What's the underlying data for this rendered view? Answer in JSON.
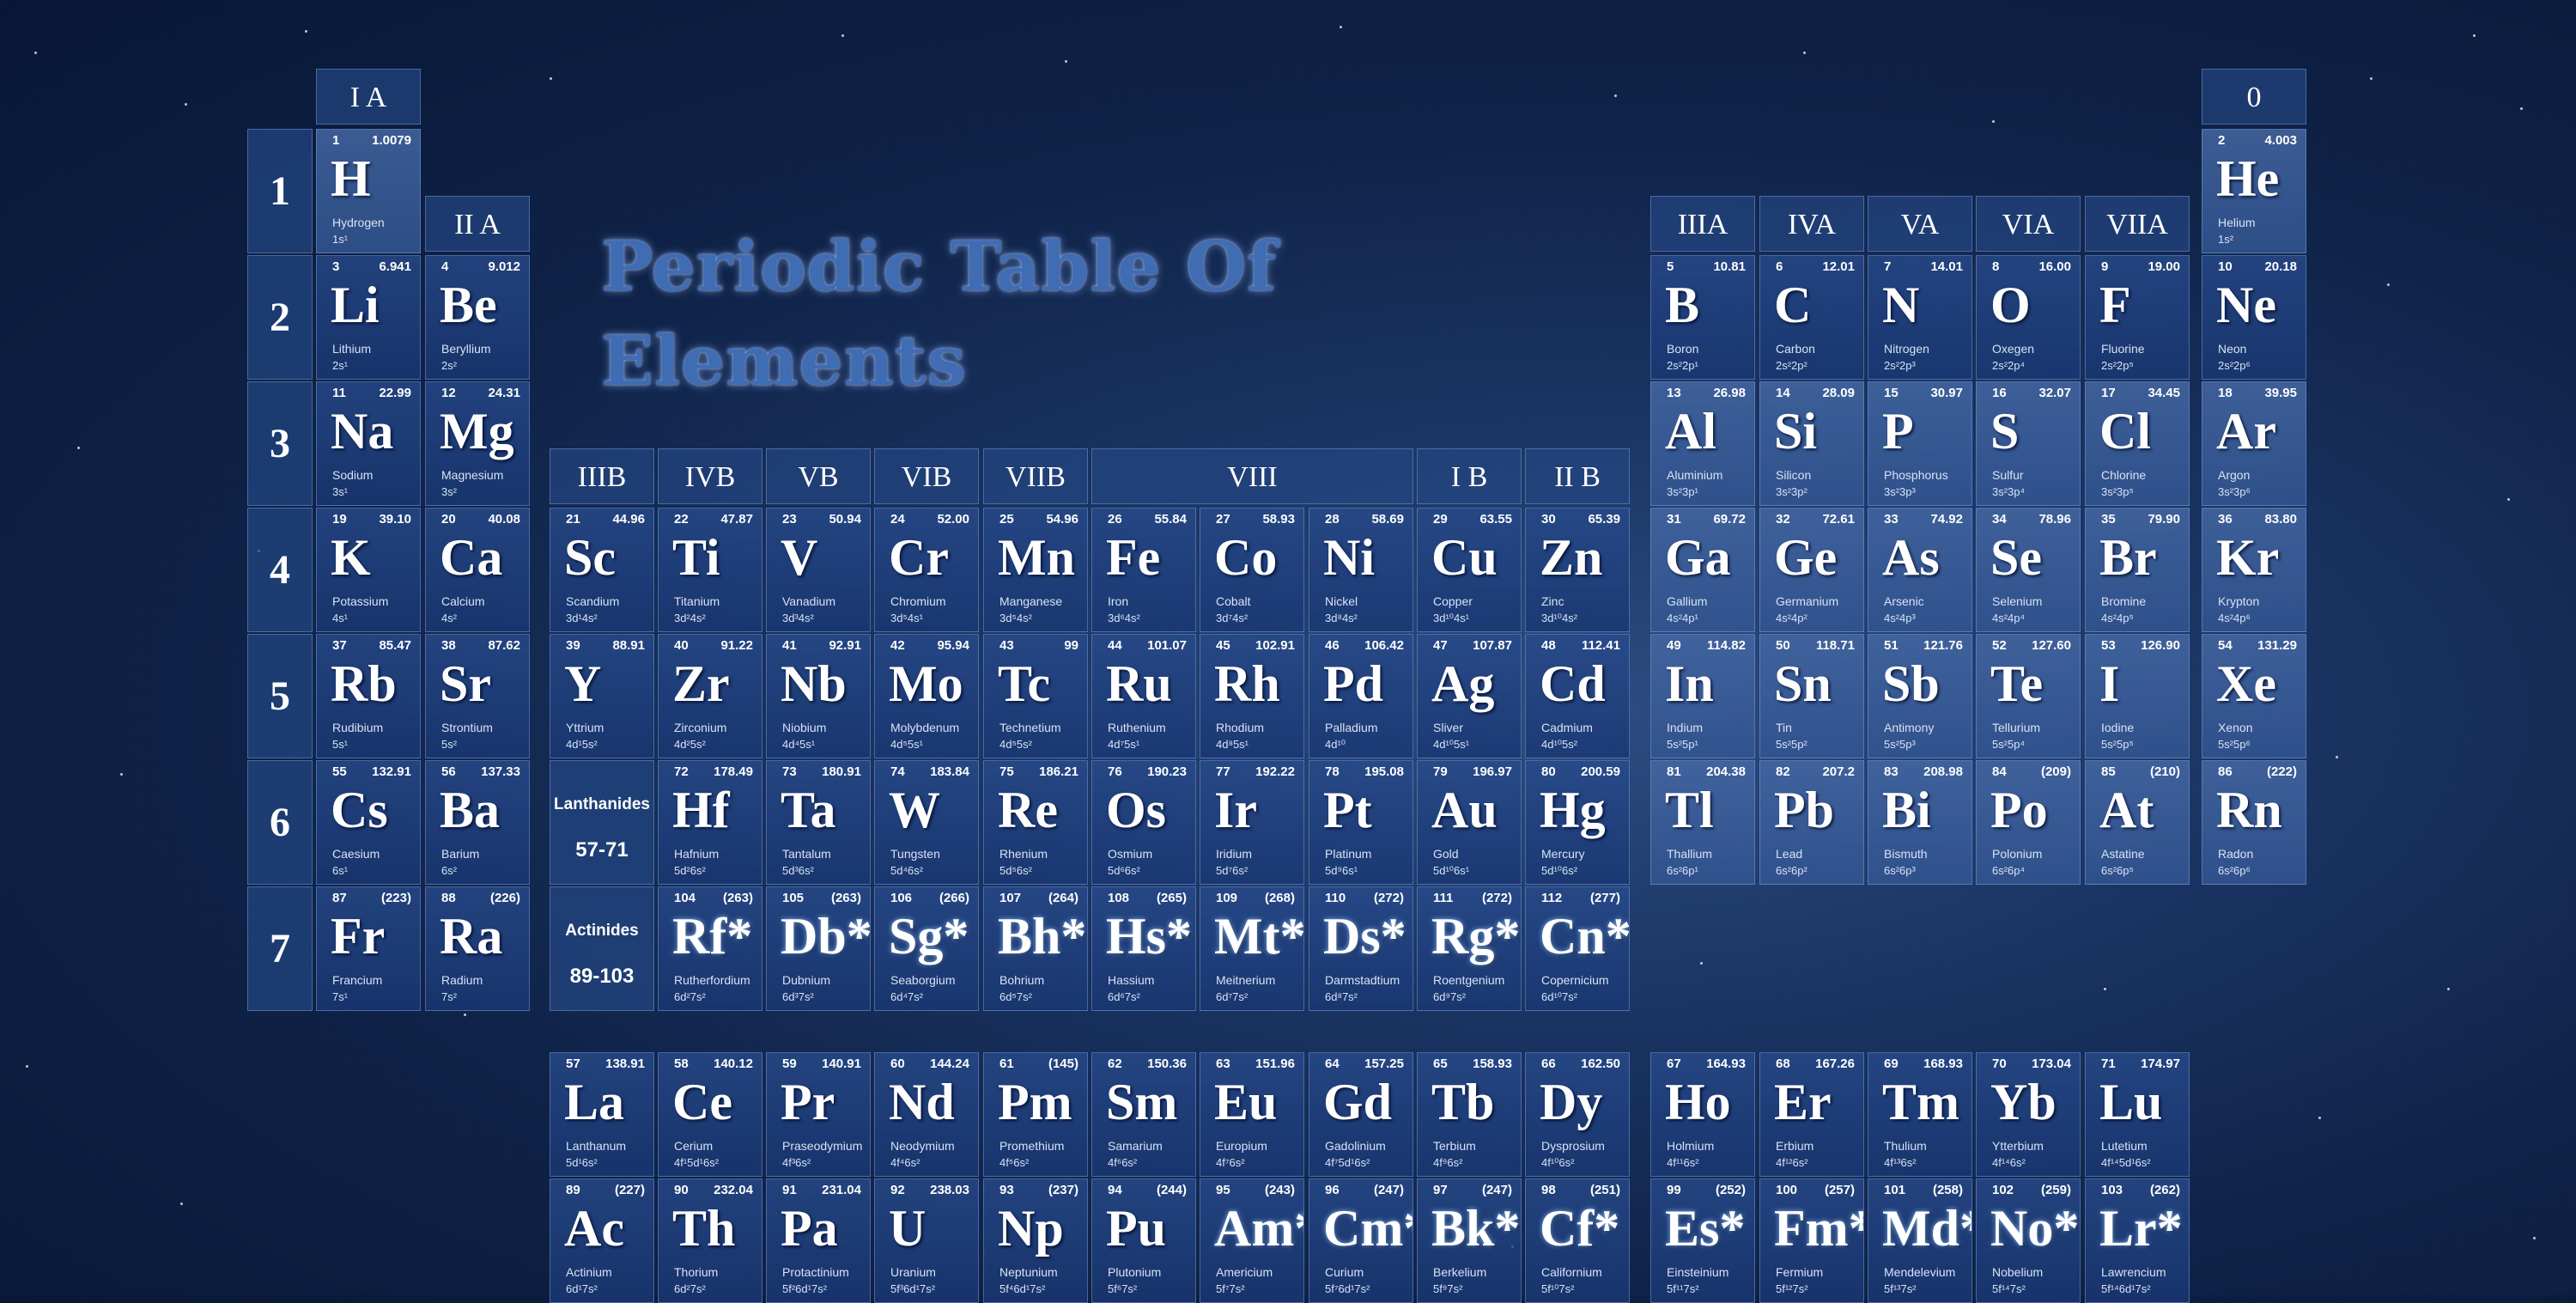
{
  "title": "Periodic Table Of Elements",
  "groups": [
    {
      "label": "I A"
    },
    {
      "label": "II A"
    },
    {
      "label": "IIIB"
    },
    {
      "label": "IVB"
    },
    {
      "label": "VB"
    },
    {
      "label": "VIB"
    },
    {
      "label": "VIIB"
    },
    {
      "label": "VIII"
    },
    {
      "label": "I B"
    },
    {
      "label": "II B"
    },
    {
      "label": "IIIA"
    },
    {
      "label": "IVA"
    },
    {
      "label": "VA"
    },
    {
      "label": "VIA"
    },
    {
      "label": "VIIA"
    },
    {
      "label": "0"
    }
  ],
  "periods": [
    "1",
    "2",
    "3",
    "4",
    "5",
    "6",
    "7"
  ],
  "series_labels": [
    {
      "l1": "Lanthanides",
      "l2": "57-71"
    },
    {
      "l1": "Actinides",
      "l2": "89-103"
    }
  ],
  "elements": [
    {
      "n": "1",
      "m": "1.0079",
      "s": "H",
      "name": "Hydrogen",
      "c": "1s¹"
    },
    {
      "n": "2",
      "m": "4.003",
      "s": "He",
      "name": "Helium",
      "c": "1s²"
    },
    {
      "n": "3",
      "m": "6.941",
      "s": "Li",
      "name": "Lithium",
      "c": "2s¹"
    },
    {
      "n": "4",
      "m": "9.012",
      "s": "Be",
      "name": "Beryllium",
      "c": "2s²"
    },
    {
      "n": "5",
      "m": "10.81",
      "s": "B",
      "name": "Boron",
      "c": "2s²2p¹"
    },
    {
      "n": "6",
      "m": "12.01",
      "s": "C",
      "name": "Carbon",
      "c": "2s²2p²"
    },
    {
      "n": "7",
      "m": "14.01",
      "s": "N",
      "name": "Nitrogen",
      "c": "2s²2p³"
    },
    {
      "n": "8",
      "m": "16.00",
      "s": "O",
      "name": "Oxegen",
      "c": "2s²2p⁴"
    },
    {
      "n": "9",
      "m": "19.00",
      "s": "F",
      "name": "Fluorine",
      "c": "2s²2p⁵"
    },
    {
      "n": "10",
      "m": "20.18",
      "s": "Ne",
      "name": "Neon",
      "c": "2s²2p⁶"
    },
    {
      "n": "11",
      "m": "22.99",
      "s": "Na",
      "name": "Sodium",
      "c": "3s¹"
    },
    {
      "n": "12",
      "m": "24.31",
      "s": "Mg",
      "name": "Magnesium",
      "c": "3s²"
    },
    {
      "n": "13",
      "m": "26.98",
      "s": "Al",
      "name": "Aluminium",
      "c": "3s²3p¹"
    },
    {
      "n": "14",
      "m": "28.09",
      "s": "Si",
      "name": "Silicon",
      "c": "3s²3p²"
    },
    {
      "n": "15",
      "m": "30.97",
      "s": "P",
      "name": "Phosphorus",
      "c": "3s²3p³"
    },
    {
      "n": "16",
      "m": "32.07",
      "s": "S",
      "name": "Sulfur",
      "c": "3s²3p⁴"
    },
    {
      "n": "17",
      "m": "34.45",
      "s": "Cl",
      "name": "Chlorine",
      "c": "3s²3p⁵"
    },
    {
      "n": "18",
      "m": "39.95",
      "s": "Ar",
      "name": "Argon",
      "c": "3s²3p⁶"
    },
    {
      "n": "19",
      "m": "39.10",
      "s": "K",
      "name": "Potassium",
      "c": "4s¹"
    },
    {
      "n": "20",
      "m": "40.08",
      "s": "Ca",
      "name": "Calcium",
      "c": "4s²"
    },
    {
      "n": "21",
      "m": "44.96",
      "s": "Sc",
      "name": "Scandium",
      "c": "3d¹4s²"
    },
    {
      "n": "22",
      "m": "47.87",
      "s": "Ti",
      "name": "Titanium",
      "c": "3d²4s²"
    },
    {
      "n": "23",
      "m": "50.94",
      "s": "V",
      "name": "Vanadium",
      "c": "3d³4s²"
    },
    {
      "n": "24",
      "m": "52.00",
      "s": "Cr",
      "name": "Chromium",
      "c": "3d⁵4s¹"
    },
    {
      "n": "25",
      "m": "54.96",
      "s": "Mn",
      "name": "Manganese",
      "c": "3d⁵4s²"
    },
    {
      "n": "26",
      "m": "55.84",
      "s": "Fe",
      "name": "Iron",
      "c": "3d⁶4s²"
    },
    {
      "n": "27",
      "m": "58.93",
      "s": "Co",
      "name": "Cobalt",
      "c": "3d⁷4s²"
    },
    {
      "n": "28",
      "m": "58.69",
      "s": "Ni",
      "name": "Nickel",
      "c": "3d⁸4s²"
    },
    {
      "n": "29",
      "m": "63.55",
      "s": "Cu",
      "name": "Copper",
      "c": "3d¹⁰4s¹"
    },
    {
      "n": "30",
      "m": "65.39",
      "s": "Zn",
      "name": "Zinc",
      "c": "3d¹⁰4s²"
    },
    {
      "n": "31",
      "m": "69.72",
      "s": "Ga",
      "name": "Gallium",
      "c": "4s²4p¹"
    },
    {
      "n": "32",
      "m": "72.61",
      "s": "Ge",
      "name": "Germanium",
      "c": "4s²4p²"
    },
    {
      "n": "33",
      "m": "74.92",
      "s": "As",
      "name": "Arsenic",
      "c": "4s²4p³"
    },
    {
      "n": "34",
      "m": "78.96",
      "s": "Se",
      "name": "Selenium",
      "c": "4s²4p⁴"
    },
    {
      "n": "35",
      "m": "79.90",
      "s": "Br",
      "name": "Bromine",
      "c": "4s²4p⁵"
    },
    {
      "n": "36",
      "m": "83.80",
      "s": "Kr",
      "name": "Krypton",
      "c": "4s²4p⁶"
    },
    {
      "n": "37",
      "m": "85.47",
      "s": "Rb",
      "name": "Rudibium",
      "c": "5s¹"
    },
    {
      "n": "38",
      "m": "87.62",
      "s": "Sr",
      "name": "Strontium",
      "c": "5s²"
    },
    {
      "n": "39",
      "m": "88.91",
      "s": "Y",
      "name": "Yttrium",
      "c": "4d¹5s²"
    },
    {
      "n": "40",
      "m": "91.22",
      "s": "Zr",
      "name": "Zirconium",
      "c": "4d²5s²"
    },
    {
      "n": "41",
      "m": "92.91",
      "s": "Nb",
      "name": "Niobium",
      "c": "4d⁴5s¹"
    },
    {
      "n": "42",
      "m": "95.94",
      "s": "Mo",
      "name": "Molybdenum",
      "c": "4d⁵5s¹"
    },
    {
      "n": "43",
      "m": "99",
      "s": "Tc",
      "name": "Technetium",
      "c": "4d⁵5s²"
    },
    {
      "n": "44",
      "m": "101.07",
      "s": "Ru",
      "name": "Ruthenium",
      "c": "4d⁷5s¹"
    },
    {
      "n": "45",
      "m": "102.91",
      "s": "Rh",
      "name": "Rhodium",
      "c": "4d⁸5s¹"
    },
    {
      "n": "46",
      "m": "106.42",
      "s": "Pd",
      "name": "Palladium",
      "c": "4d¹⁰"
    },
    {
      "n": "47",
      "m": "107.87",
      "s": "Ag",
      "name": "Sliver",
      "c": "4d¹⁰5s¹"
    },
    {
      "n": "48",
      "m": "112.41",
      "s": "Cd",
      "name": "Cadmium",
      "c": "4d¹⁰5s²"
    },
    {
      "n": "49",
      "m": "114.82",
      "s": "In",
      "name": "Indium",
      "c": "5s²5p¹"
    },
    {
      "n": "50",
      "m": "118.71",
      "s": "Sn",
      "name": "Tin",
      "c": "5s²5p²"
    },
    {
      "n": "51",
      "m": "121.76",
      "s": "Sb",
      "name": "Antimony",
      "c": "5s²5p³"
    },
    {
      "n": "52",
      "m": "127.60",
      "s": "Te",
      "name": "Tellurium",
      "c": "5s²5p⁴"
    },
    {
      "n": "53",
      "m": "126.90",
      "s": "I",
      "name": "Iodine",
      "c": "5s²5p⁵"
    },
    {
      "n": "54",
      "m": "131.29",
      "s": "Xe",
      "name": "Xenon",
      "c": "5s²5p⁶"
    },
    {
      "n": "55",
      "m": "132.91",
      "s": "Cs",
      "name": "Caesium",
      "c": "6s¹"
    },
    {
      "n": "56",
      "m": "137.33",
      "s": "Ba",
      "name": "Barium",
      "c": "6s²"
    },
    {
      "n": "72",
      "m": "178.49",
      "s": "Hf",
      "name": "Hafnium",
      "c": "5d²6s²"
    },
    {
      "n": "73",
      "m": "180.91",
      "s": "Ta",
      "name": "Tantalum",
      "c": "5d³6s²"
    },
    {
      "n": "74",
      "m": "183.84",
      "s": "W",
      "name": "Tungsten",
      "c": "5d⁴6s²"
    },
    {
      "n": "75",
      "m": "186.21",
      "s": "Re",
      "name": "Rhenium",
      "c": "5d⁵6s²"
    },
    {
      "n": "76",
      "m": "190.23",
      "s": "Os",
      "name": "Osmium",
      "c": "5d⁶6s²"
    },
    {
      "n": "77",
      "m": "192.22",
      "s": "Ir",
      "name": "Iridium",
      "c": "5d⁷6s²"
    },
    {
      "n": "78",
      "m": "195.08",
      "s": "Pt",
      "name": "Platinum",
      "c": "5d⁹6s¹"
    },
    {
      "n": "79",
      "m": "196.97",
      "s": "Au",
      "name": "Gold",
      "c": "5d¹⁰6s¹"
    },
    {
      "n": "80",
      "m": "200.59",
      "s": "Hg",
      "name": "Mercury",
      "c": "5d¹⁰6s²"
    },
    {
      "n": "81",
      "m": "204.38",
      "s": "Tl",
      "name": "Thallium",
      "c": "6s²6p¹"
    },
    {
      "n": "82",
      "m": "207.2",
      "s": "Pb",
      "name": "Lead",
      "c": "6s²6p²"
    },
    {
      "n": "83",
      "m": "208.98",
      "s": "Bi",
      "name": "Bismuth",
      "c": "6s²6p³"
    },
    {
      "n": "84",
      "m": "(209)",
      "s": "Po",
      "name": "Polonium",
      "c": "6s²6p⁴"
    },
    {
      "n": "85",
      "m": "(210)",
      "s": "At",
      "name": "Astatine",
      "c": "6s²6p⁵"
    },
    {
      "n": "86",
      "m": "(222)",
      "s": "Rn",
      "name": "Radon",
      "c": "6s²6p⁶"
    },
    {
      "n": "87",
      "m": "(223)",
      "s": "Fr",
      "name": "Francium",
      "c": "7s¹"
    },
    {
      "n": "88",
      "m": "(226)",
      "s": "Ra",
      "name": "Radium",
      "c": "7s²"
    },
    {
      "n": "104",
      "m": "(263)",
      "s": "Rf*",
      "name": "Rutherfordium",
      "c": "6d²7s²"
    },
    {
      "n": "105",
      "m": "(263)",
      "s": "Db*",
      "name": "Dubnium",
      "c": "6d³7s²"
    },
    {
      "n": "106",
      "m": "(266)",
      "s": "Sg*",
      "name": "Seaborgium",
      "c": "6d⁴7s²"
    },
    {
      "n": "107",
      "m": "(264)",
      "s": "Bh*",
      "name": "Bohrium",
      "c": "6d⁵7s²"
    },
    {
      "n": "108",
      "m": "(265)",
      "s": "Hs*",
      "name": "Hassium",
      "c": "6d⁶7s²"
    },
    {
      "n": "109",
      "m": "(268)",
      "s": "Mt*",
      "name": "Meitnerium",
      "c": "6d⁷7s²"
    },
    {
      "n": "110",
      "m": "(272)",
      "s": "Ds*",
      "name": "Darmstadtium",
      "c": "6d⁸7s²"
    },
    {
      "n": "111",
      "m": "(272)",
      "s": "Rg*",
      "name": "Roentgenium",
      "c": "6d⁹7s²"
    },
    {
      "n": "112",
      "m": "(277)",
      "s": "Cn*",
      "name": "Copernicium",
      "c": "6d¹⁰7s²"
    },
    {
      "n": "57",
      "m": "138.91",
      "s": "La",
      "name": "Lanthanum",
      "c": "5d¹6s²"
    },
    {
      "n": "58",
      "m": "140.12",
      "s": "Ce",
      "name": "Cerium",
      "c": "4f¹5d¹6s²"
    },
    {
      "n": "59",
      "m": "140.91",
      "s": "Pr",
      "name": "Praseodymium",
      "c": "4f³6s²"
    },
    {
      "n": "60",
      "m": "144.24",
      "s": "Nd",
      "name": "Neodymium",
      "c": "4f⁴6s²"
    },
    {
      "n": "61",
      "m": "(145)",
      "s": "Pm",
      "name": "Promethium",
      "c": "4f⁵6s²"
    },
    {
      "n": "62",
      "m": "150.36",
      "s": "Sm",
      "name": "Samarium",
      "c": "4f⁶6s²"
    },
    {
      "n": "63",
      "m": "151.96",
      "s": "Eu",
      "name": "Europium",
      "c": "4f⁷6s²"
    },
    {
      "n": "64",
      "m": "157.25",
      "s": "Gd",
      "name": "Gadolinium",
      "c": "4f⁷5d¹6s²"
    },
    {
      "n": "65",
      "m": "158.93",
      "s": "Tb",
      "name": "Terbium",
      "c": "4f⁹6s²"
    },
    {
      "n": "66",
      "m": "162.50",
      "s": "Dy",
      "name": "Dysprosium",
      "c": "4f¹⁰6s²"
    },
    {
      "n": "67",
      "m": "164.93",
      "s": "Ho",
      "name": "Holmium",
      "c": "4f¹¹6s²"
    },
    {
      "n": "68",
      "m": "167.26",
      "s": "Er",
      "name": "Erbium",
      "c": "4f¹²6s²"
    },
    {
      "n": "69",
      "m": "168.93",
      "s": "Tm",
      "name": "Thulium",
      "c": "4f¹³6s²"
    },
    {
      "n": "70",
      "m": "173.04",
      "s": "Yb",
      "name": "Ytterbium",
      "c": "4f¹⁴6s²"
    },
    {
      "n": "71",
      "m": "174.97",
      "s": "Lu",
      "name": "Lutetium",
      "c": "4f¹⁴5d¹6s²"
    },
    {
      "n": "89",
      "m": "(227)",
      "s": "Ac",
      "name": "Actinium",
      "c": "6d¹7s²"
    },
    {
      "n": "90",
      "m": "232.04",
      "s": "Th",
      "name": "Thorium",
      "c": "6d²7s²"
    },
    {
      "n": "91",
      "m": "231.04",
      "s": "Pa",
      "name": "Protactinium",
      "c": "5f²6d¹7s²"
    },
    {
      "n": "92",
      "m": "238.03",
      "s": "U",
      "name": "Uranium",
      "c": "5f³6d¹7s²"
    },
    {
      "n": "93",
      "m": "(237)",
      "s": "Np",
      "name": "Neptunium",
      "c": "5f⁴6d¹7s²"
    },
    {
      "n": "94",
      "m": "(244)",
      "s": "Pu",
      "name": "Plutonium",
      "c": "5f⁶7s²"
    },
    {
      "n": "95",
      "m": "(243)",
      "s": "Am*",
      "name": "Americium",
      "c": "5f⁷7s²"
    },
    {
      "n": "96",
      "m": "(247)",
      "s": "Cm*",
      "name": "Curium",
      "c": "5f⁷6d¹7s²"
    },
    {
      "n": "97",
      "m": "(247)",
      "s": "Bk*",
      "name": "Berkelium",
      "c": "5f⁹7s²"
    },
    {
      "n": "98",
      "m": "(251)",
      "s": "Cf*",
      "name": "Californium",
      "c": "5f¹⁰7s²"
    },
    {
      "n": "99",
      "m": "(252)",
      "s": "Es*",
      "name": "Einsteinium",
      "c": "5f¹¹7s²"
    },
    {
      "n": "100",
      "m": "(257)",
      "s": "Fm*",
      "name": "Fermium",
      "c": "5f¹²7s²"
    },
    {
      "n": "101",
      "m": "(258)",
      "s": "Md*",
      "name": "Mendelevium",
      "c": "5f¹³7s²"
    },
    {
      "n": "102",
      "m": "(259)",
      "s": "No*",
      "name": "Nobelium",
      "c": "5f¹⁴7s²"
    },
    {
      "n": "103",
      "m": "(262)",
      "s": "Lr*",
      "name": "Lawrencium",
      "c": "5f¹⁴6d¹7s²"
    }
  ]
}
